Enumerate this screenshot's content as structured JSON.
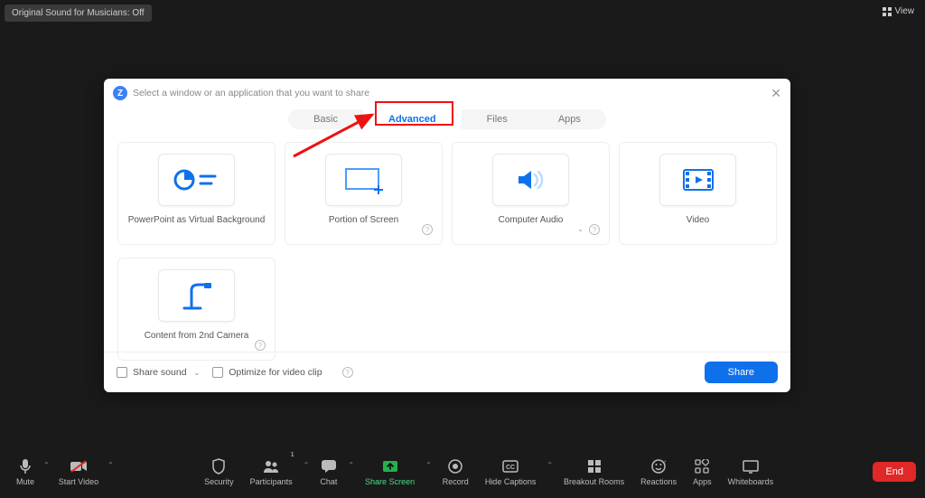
{
  "top": {
    "sound_badge": "Original Sound for Musicians: Off",
    "view": "View"
  },
  "dialog": {
    "title": "Select a window or an application that you want to share",
    "tabs": [
      "Basic",
      "Advanced",
      "Files",
      "Apps"
    ],
    "active_tab": 1,
    "cards": {
      "ppt": "PowerPoint as Virtual Background",
      "portion": "Portion of Screen",
      "audio": "Computer Audio",
      "video": "Video",
      "camera": "Content from 2nd Camera"
    },
    "footer": {
      "share_sound": "Share sound",
      "optimize": "Optimize for video clip",
      "share": "Share"
    }
  },
  "bottombar": {
    "mute": "Mute",
    "start_video": "Start Video",
    "security": "Security",
    "participants": "Participants",
    "participants_count": "1",
    "chat": "Chat",
    "share_screen": "Share Screen",
    "record": "Record",
    "hide_captions": "Hide Captions",
    "breakout": "Breakout Rooms",
    "reactions": "Reactions",
    "apps": "Apps",
    "whiteboards": "Whiteboards",
    "end": "End"
  }
}
